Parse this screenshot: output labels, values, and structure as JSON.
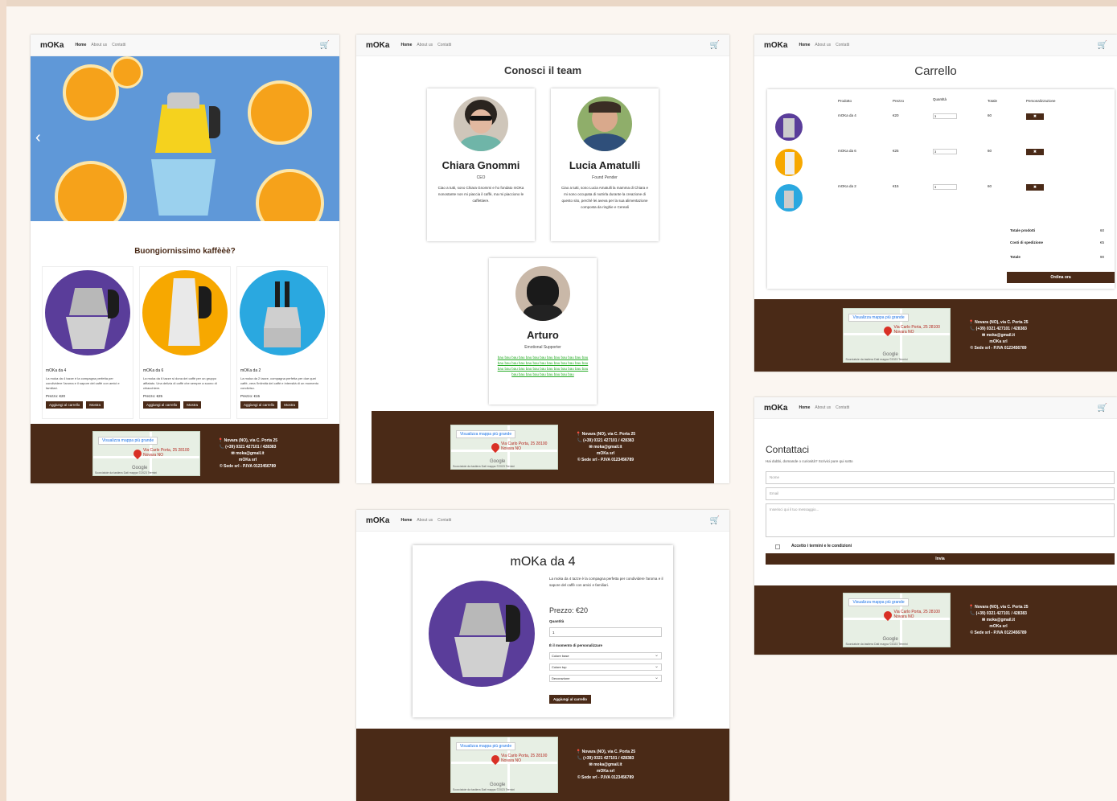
{
  "brand": "mOKa",
  "nav": {
    "home": "Home",
    "about": "About us",
    "contact": "Contatti"
  },
  "icons": {
    "cart": "cart-icon",
    "pin": "map-pin-icon",
    "phone": "phone-icon",
    "mail": "mail-icon"
  },
  "colors": {
    "brand_dark": "#4a2a17",
    "orange": "#f7a800",
    "purple": "#5a3d9a",
    "blue": "#2aa8e0"
  },
  "home": {
    "hero_arrow": "‹",
    "tagline": "Buongiornissimo kaffèèè?",
    "products": [
      {
        "name": "mOKa da 4",
        "desc": "La moka da 4 tazze è la compagna perfetta per condividere l'aroma e il sapore del caffè con amici e familiari.",
        "price": "Prezzo: €20",
        "add": "Aggiungi al carrello",
        "more": "Mostra"
      },
      {
        "name": "mOKa da 6",
        "desc": "La moka da 6 tazze si dona dei caffè per un gruppo affiatato. Una delizia di caffè che sempre a suono di chiacchiere.",
        "price": "Prezzo: €25",
        "add": "Aggiungi al carrello",
        "more": "Mostra"
      },
      {
        "name": "mOKa da 2",
        "desc": "La moka da 2 tazze, compagna perfetta per due quei caffè, vera l'intimità del caffè e intensità di un momento condiviso.",
        "price": "Prezzo: €15",
        "add": "Aggiungi al carrello",
        "more": "Mostra"
      }
    ]
  },
  "team": {
    "title": "Conosci il team",
    "members": [
      {
        "name": "Chiara Gnommi",
        "role": "CEO",
        "desc": "Ciao a tutti, sono Chiara Gnommi e ho fondato mOKa nonostante non mi piaccia il caffè, ma mi piacciono le caffettiere."
      },
      {
        "name": "Lucia Amatulli",
        "role": "Found Pender",
        "desc": "Ciao a tutti, sono Lucia Amatulli la mamma di Chiara e mi sono occupata di nutrirla durante la creazione di questo sito, perché lei aveva per la sua alimentazione composta da ringhie e Cereali"
      },
      {
        "name": "Arturo",
        "role": "Emotional Supporter",
        "desc": "bau bau bau bau bau bau bau bau bau bau bau bau bau bau bau bau bau bau bau bau bau bau bau bau bau bau bau bau bau bau bau bau bau bau bau bau bau bau bau bau bau bau bau bau bau bau bau bau"
      }
    ]
  },
  "cart": {
    "title": "Carrello",
    "headers": {
      "product": "Prodotto",
      "price": "Prezzo",
      "qty": "Quantità",
      "total": "Totale",
      "custom": "Personalizzazione"
    },
    "rows": [
      {
        "name": "mOKa da 4",
        "price": "€20",
        "qty": "3",
        "total": "60",
        "x": "✖"
      },
      {
        "name": "mOKa da 6",
        "price": "€25",
        "qty": "3",
        "total": "60",
        "x": "✖"
      },
      {
        "name": "mOKa da 2",
        "price": "€15",
        "qty": "3",
        "total": "60",
        "x": "✖"
      }
    ],
    "summary": [
      {
        "label": "Totale prodotti",
        "value": "60"
      },
      {
        "label": "Costi di spedizione",
        "value": "€5"
      },
      {
        "label": "Totale",
        "value": "90"
      }
    ],
    "checkout": "Ordina ora"
  },
  "detail": {
    "title": "mOKa da 4",
    "desc": "La moka da 4 tazze è la compagna perfetta per condividere l'aroma e il sapore del caffè con amici e familiari.",
    "price": "Prezzo: €20",
    "qty_label": "Quantità",
    "qty_value": "1",
    "custom_label": "È il momento di personalizzare",
    "selects": [
      "Colore base",
      "Colore top",
      "Decorazione"
    ],
    "add": "Aggiungi al carrello"
  },
  "contact": {
    "title": "Contattaci",
    "sub": "Hai dubbi, domande o curiosità? Scrivici pure qui sotto",
    "name_ph": "Nome",
    "email_ph": "Email",
    "msg_ph": "Inserisci qui il tuo messaggio...",
    "terms": "Accetto i termini e le condizioni",
    "send": "Invia"
  },
  "footer": {
    "address": "📍 Novara (NO), via C. Porta 25",
    "phone": "📞 (+39) 0321 427101 / 428383",
    "email": "✉ moka@gmail.it",
    "brand": "mOKa srl",
    "legal": "© Sede srl - P.IVA 0123456789",
    "map_btn": "Visualizza mappa più grande",
    "map_place": "Via Carlo Porta, 25 28100 Novara NO",
    "map_google": "Google",
    "map_attr": "Scorciatoie da tastiera  Dati mappa ©2023  Termini"
  }
}
